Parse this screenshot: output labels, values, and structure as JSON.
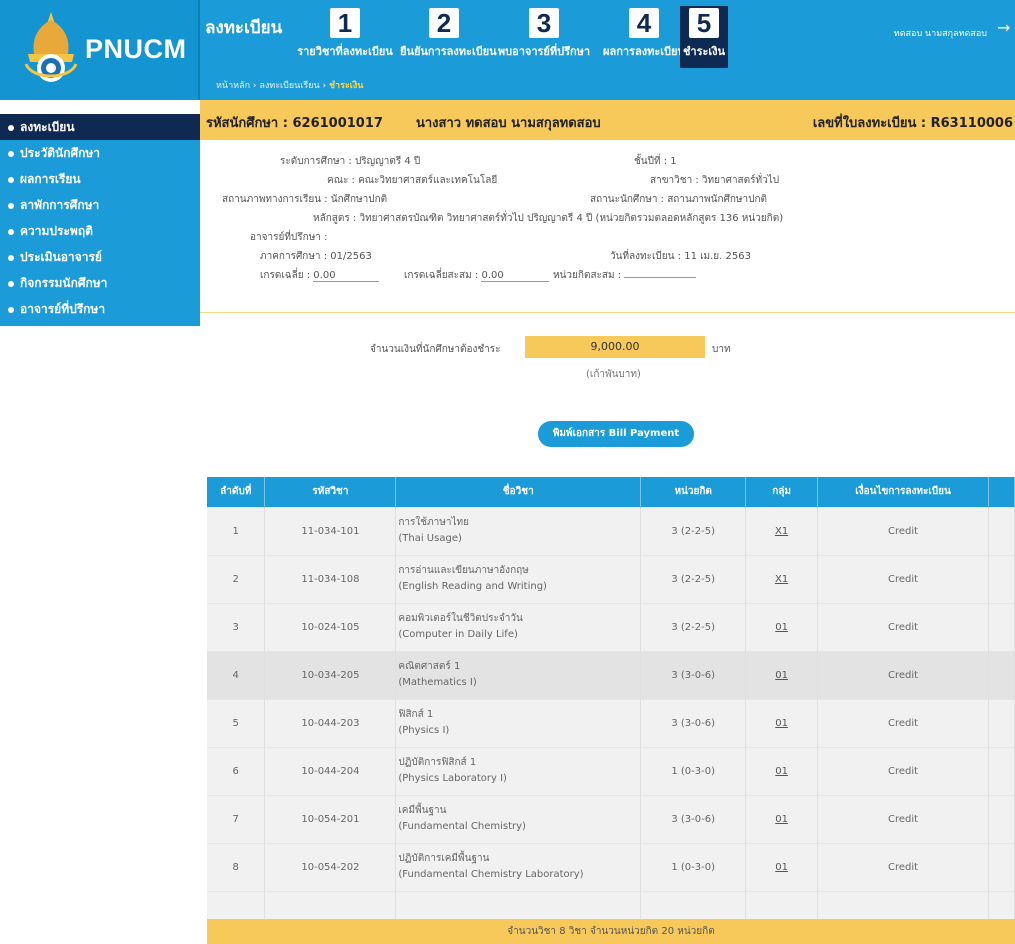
{
  "app": {
    "logo_text": "PNUCM",
    "register_title": "ลงทะเบียน",
    "user_label": "ทดสอบ นามสกุลทดสอบ"
  },
  "steps": [
    {
      "num": "1",
      "label": "รายวิชาที่ลงทะเบียน"
    },
    {
      "num": "2",
      "label": "ยืนยันการลงทะเบียน"
    },
    {
      "num": "3",
      "label": "พบอาจารย์ที่ปรึกษา"
    },
    {
      "num": "4",
      "label": "ผลการลงทะเบียน"
    },
    {
      "num": "5",
      "label": "ชำระเงิน"
    }
  ],
  "breadcrumb": {
    "home": "หน้าหลัก",
    "section": "ลงทะเบียนเรียน",
    "current": "ชำระเงิน",
    "sep": " › "
  },
  "sidebar": {
    "items": [
      {
        "label": "ลงทะเบียน"
      },
      {
        "label": "ประวัตินักศึกษา"
      },
      {
        "label": "ผลการเรียน"
      },
      {
        "label": "ลาพักการศึกษา"
      },
      {
        "label": "ความประพฤติ"
      },
      {
        "label": "ประเมินอาจารย์"
      },
      {
        "label": "กิจกรรมนักศึกษา"
      },
      {
        "label": "อาจารย์ที่ปรึกษา"
      }
    ]
  },
  "student": {
    "id_label": "รหัสนักศึกษา : 6261001017",
    "name": "นางสาว ทดสอบ นามสกุลทดสอบ",
    "reg_no_label": "เลขที่ใบลงทะเบียน : R63110006"
  },
  "details": {
    "level": "ระดับการศึกษา : ปริญญาตรี 4 ปี",
    "year": "ชั้นปีที่ : 1",
    "faculty": "คณะ : คณะวิทยาศาสตร์และเทคโนโลยี",
    "major": "สาขาวิชา : วิทยาศาสตร์ทั่วไป",
    "study_status": "สถานภาพทางการเรียน : นักศึกษาปกติ",
    "student_status": "สถานะนักศึกษา : สถานภาพนักศึกษาปกติ",
    "curriculum": "หลักสูตร : วิทยาศาสตรบัณฑิต วิทยาศาสตร์ทั่วไป ปริญญาตรี 4 ปี (หน่วยกิตรวมตลอดหลักสูตร 136 หน่วยกิต)",
    "advisor": "อาจารย์ที่ปรึกษา :",
    "semester": "ภาคการศึกษา : 01/2563",
    "reg_date": "วันที่ลงทะเบียน : 11 เม.ย. 2563",
    "gpa_label": "เกรดเฉลี่ย :",
    "gpa_value": "0.00",
    "gpax_label": "เกรดเฉลี่ยสะสม :",
    "gpax_value": "0.00",
    "credits_label": "หน่วยกิตสะสม :",
    "credits_value": ""
  },
  "payment": {
    "label": "จำนวนเงินที่นักศึกษาต้องชำระ",
    "amount": "9,000.00",
    "unit": "บาท",
    "words": "(เก้าพันบาท)",
    "bill_button": "พิมพ์เอกสาร Bill Payment"
  },
  "table": {
    "headers": [
      "ลำดับที่",
      "รหัสวิชา",
      "ชื่อวิชา",
      "หน่วยกิต",
      "กลุ่ม",
      "เงื่อนไขการลงทะเบียน"
    ],
    "rows": [
      {
        "no": "1",
        "code": "11-034-101",
        "name_th": "การใช้ภาษาไทย",
        "name_en": "(Thai Usage)",
        "credit": "3 (2-2-5)",
        "group": "X1",
        "cond": "Credit"
      },
      {
        "no": "2",
        "code": "11-034-108",
        "name_th": "การอ่านและเขียนภาษาอังกฤษ",
        "name_en": "(English Reading and Writing)",
        "credit": "3 (2-2-5)",
        "group": "X1",
        "cond": "Credit"
      },
      {
        "no": "3",
        "code": "10-024-105",
        "name_th": "คอมพิวเตอร์ในชีวิตประจำวัน",
        "name_en": "(Computer in Daily Life)",
        "credit": "3 (2-2-5)",
        "group": "01",
        "cond": "Credit"
      },
      {
        "no": "4",
        "code": "10-034-205",
        "name_th": "คณิตศาสตร์ 1",
        "name_en": "(Mathematics I)",
        "credit": "3 (3-0-6)",
        "group": "01",
        "cond": "Credit"
      },
      {
        "no": "5",
        "code": "10-044-203",
        "name_th": "ฟิสิกส์ 1",
        "name_en": "(Physics I)",
        "credit": "3 (3-0-6)",
        "group": "01",
        "cond": "Credit"
      },
      {
        "no": "6",
        "code": "10-044-204",
        "name_th": "ปฏิบัติการฟิสิกส์ 1",
        "name_en": "(Physics Laboratory I)",
        "credit": "1 (0-3-0)",
        "group": "01",
        "cond": "Credit"
      },
      {
        "no": "7",
        "code": "10-054-201",
        "name_th": "เคมีพื้นฐาน",
        "name_en": "(Fundamental Chemistry)",
        "credit": "3 (3-0-6)",
        "group": "01",
        "cond": "Credit"
      },
      {
        "no": "8",
        "code": "10-054-202",
        "name_th": "ปฏิบัติการเคมีพื้นฐาน",
        "name_en": "(Fundamental Chemistry Laboratory)",
        "credit": "1 (0-3-0)",
        "group": "01",
        "cond": "Credit"
      }
    ],
    "summary": "จำนวนวิชา 8 วิชา จำนวนหน่วยกิต 20 หน่วยกิต"
  },
  "colors": {
    "primary": "#1b9bd8",
    "dark": "#0f2a52",
    "accent": "#f7c95a"
  }
}
